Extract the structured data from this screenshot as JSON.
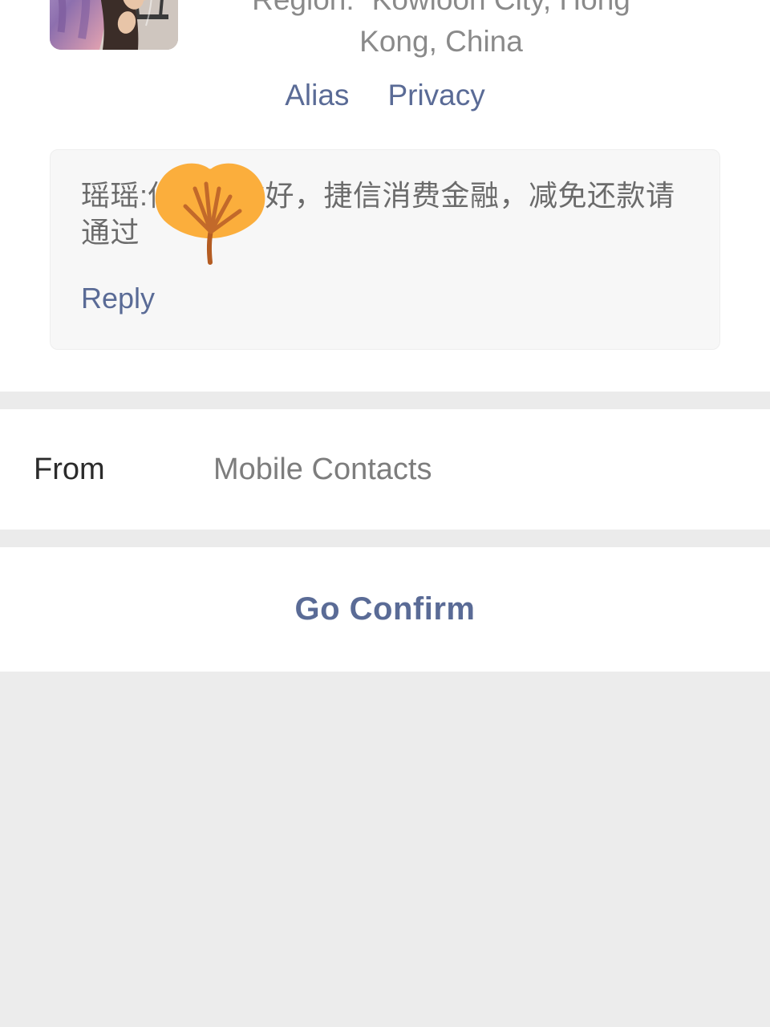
{
  "profile": {
    "avatar_alt": "contact-photo",
    "region_label": "Region:",
    "region_line_1": "Kowloon City, Hong",
    "region_line_2": "Kong, China",
    "links": [
      {
        "label": "Alias",
        "name": "alias-link"
      },
      {
        "label": "Privacy",
        "name": "privacy-link"
      }
    ]
  },
  "message": {
    "text": "瑶瑶:你发上你好，捷信消费金融，减免还款请通过",
    "reply_label": "Reply",
    "sticker": "ginkgo-leaf-sticker",
    "sticker_color": "#fbae3c",
    "sticker_stem_color": "#b45c22"
  },
  "from": {
    "label": "From",
    "value": "Mobile Contacts"
  },
  "confirm": {
    "label": "Go Confirm"
  },
  "colors": {
    "link_blue": "#5a6b96",
    "card_bg": "#f7f7f7",
    "band_gray": "#ebebeb",
    "page_gray": "#ececec",
    "body_text": "#6b6b6b"
  }
}
